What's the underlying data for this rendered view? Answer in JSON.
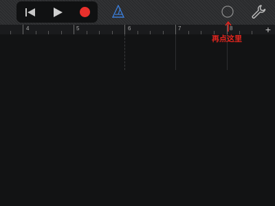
{
  "transport": {
    "rewind_icon": "skip-back-icon",
    "play_icon": "play-icon",
    "record_icon": "record-icon"
  },
  "toolbar": {
    "metronome_icon": "metronome-icon",
    "loop_icon": "loop-circle-icon",
    "settings_icon": "wrench-icon"
  },
  "ruler": {
    "markers": [
      "4",
      "5",
      "6",
      "7",
      "8"
    ],
    "add_label": "+"
  },
  "annotation": {
    "text": "再点这里"
  },
  "colors": {
    "record": "#e9302c",
    "annotation": "#e3261f",
    "metronome": "#3b7dd8"
  }
}
